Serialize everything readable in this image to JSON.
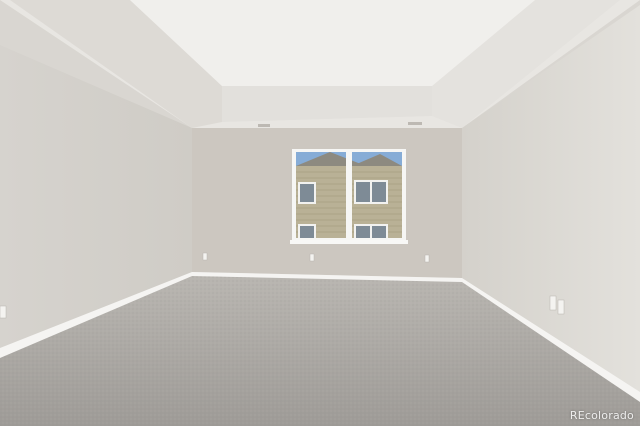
{
  "photo": {
    "watermark": "REcolorado"
  },
  "colors": {
    "ceiling": "#e9e7e3",
    "left_wall": "#d4d1cc",
    "back_wall": "#cbc6bf",
    "right_wall": "#dedbd6",
    "carpet": "#a9a6a2",
    "baseboard": "#f4f3f1",
    "window_trim": "#f7f7f5",
    "siding": "#b5ad8f",
    "sky": "#7aa3cf"
  },
  "icons": [
    "wall-outlet-icon",
    "ceiling-vent-icon"
  ]
}
